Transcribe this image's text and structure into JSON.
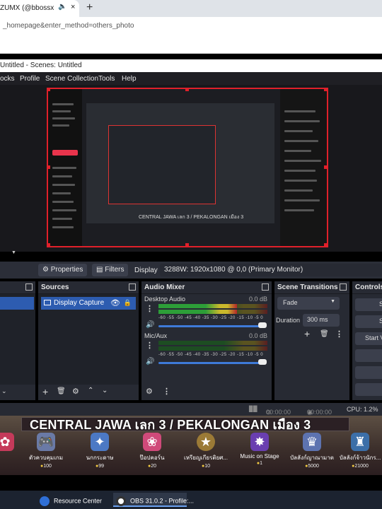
{
  "browser": {
    "tab_title": "ZUMX (@bbossxgamin",
    "tab_close": "×",
    "speaker_icon": "speaker-icon",
    "new_tab": "+",
    "address": "_homepage&enter_method=others_photo"
  },
  "obs": {
    "window_title": "Untitled - Scenes: Untitled",
    "menu": [
      "ocks",
      "Profile",
      "Scene Collection",
      "Tools",
      "Help"
    ],
    "preview": {
      "caption": "CENTRAL JAWA เลก 3 / PEKALONGAN เมือง 3"
    },
    "toolbar": {
      "properties": "Properties",
      "filters": "Filters",
      "display_label": "Display",
      "display_value": "3288W: 1920x1080 @ 0,0 (Primary Monitor)"
    },
    "sources": {
      "title": "Sources",
      "items": [
        {
          "name": "Display Capture"
        }
      ]
    },
    "audio_mixer": {
      "title": "Audio Mixer",
      "scale": "-60 -55 -50 -45 -40 -35 -30 -25 -20 -15 -10 -5 0",
      "channels": [
        {
          "name": "Desktop Audio",
          "db": "0.0 dB",
          "level": 0.72
        },
        {
          "name": "Mic/Aux",
          "db": "0.0 dB",
          "level": 0.0
        }
      ]
    },
    "scene_transitions": {
      "title": "Scene Transitions",
      "transition": "Fade",
      "duration_label": "Duration",
      "duration_value": "300 ms"
    },
    "controls": {
      "title": "Controls",
      "buttons": [
        "St",
        "St",
        "Start Vi",
        "S"
      ]
    },
    "status": {
      "rec_time": "00:00:00",
      "stream_time": "00:00:00",
      "cpu": "CPU: 1.2%"
    }
  },
  "stream": {
    "banner": "CENTRAL JAWA เลก 3 / PEKALONGAN เมือง 3",
    "gifts": [
      {
        "name": "ตัวควบคุมเกม",
        "points": "100",
        "icon": "gamepad-icon"
      },
      {
        "name": "นกกระดาษ",
        "points": "99",
        "icon": "paper-crane-icon"
      },
      {
        "name": "ป๊อปคอร์น",
        "points": "20",
        "icon": "popcorn-icon"
      },
      {
        "name": "เหรียญเกียรติยศ...",
        "points": "10",
        "icon": "medal-icon"
      },
      {
        "name": "Music on Stage",
        "points": "1",
        "icon": "stage-icon"
      },
      {
        "name": "บัลลังก์ญาณามาต",
        "points": "5000",
        "icon": "palace-icon"
      },
      {
        "name": "บัลลังก์จ้าวนักร...",
        "points": "21000",
        "icon": "throne-icon"
      }
    ]
  },
  "taskbar": {
    "items": [
      {
        "label": "Resource Center"
      },
      {
        "label": "OBS 31.0.2 - Profile:..."
      }
    ]
  }
}
